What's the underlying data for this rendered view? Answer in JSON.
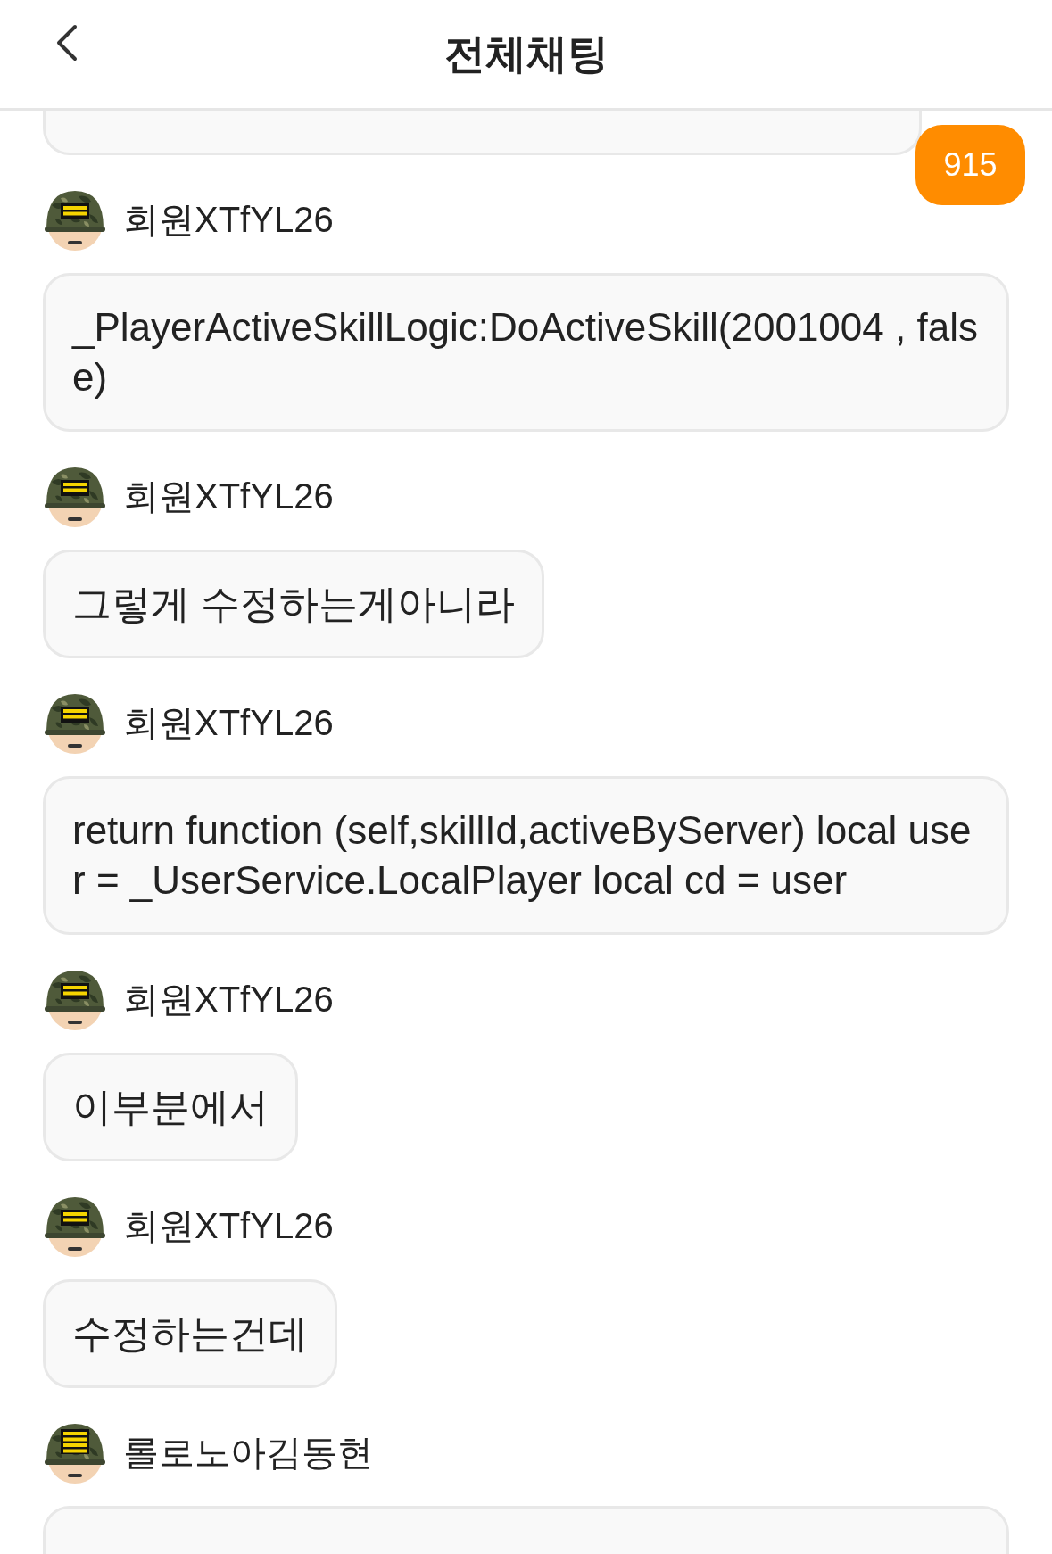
{
  "header": {
    "title": "전체채팅"
  },
  "unread_badge": "915",
  "messages": [
    {
      "author": "회원XTfYL26",
      "kind": "twobar",
      "text": "_PlayerActiveSkillLogic:DoActiveSkill(2001004 , false)"
    },
    {
      "author": "회원XTfYL26",
      "kind": "twobar",
      "text": "그렇게 수정하는게아니라"
    },
    {
      "author": "회원XTfYL26",
      "kind": "twobar",
      "text": "return function (self,skillId,activeByServer) local user = _UserService.LocalPlayer local cd = user"
    },
    {
      "author": "회원XTfYL26",
      "kind": "twobar",
      "text": "이부분에서"
    },
    {
      "author": "회원XTfYL26",
      "kind": "twobar",
      "text": "수정하는건데"
    },
    {
      "author": "롤로노아김동현",
      "kind": "fourbar"
    }
  ]
}
